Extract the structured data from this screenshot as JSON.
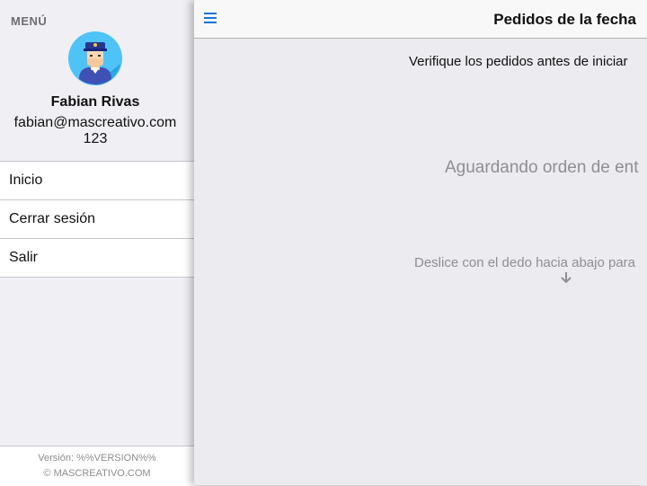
{
  "menu": {
    "title": "MENÚ",
    "user": {
      "name": "Fabian Rivas",
      "email": "fabian@mascreativo.com",
      "code": "123"
    },
    "items": [
      {
        "label": "Inicio"
      },
      {
        "label": "Cerrar sesión"
      },
      {
        "label": "Salir"
      }
    ],
    "footer": {
      "version": "Versión: %%VERSION%%",
      "copyright": "© MASCREATIVO.COM"
    }
  },
  "header": {
    "title": "Pedidos de la fecha",
    "menu_icon": "hamburger-icon"
  },
  "main": {
    "instruction": "Verifique los pedidos antes de iniciar",
    "waiting_text": "Aguardando orden de ent",
    "swipe_hint": "Deslice con el dedo hacia abajo para",
    "swipe_icon": "arrow-down-icon"
  },
  "colors": {
    "accent": "#1976d2",
    "background": "#ebebf0",
    "muted_text": "#8e8e93"
  }
}
